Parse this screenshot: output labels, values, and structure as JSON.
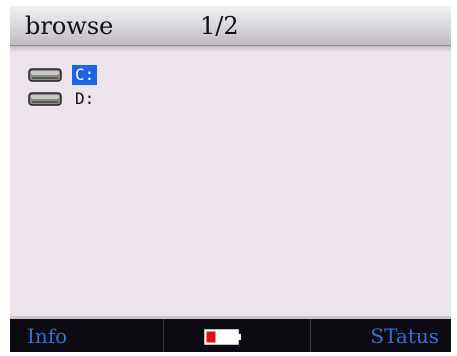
{
  "header": {
    "title": "browse",
    "page": "1/2"
  },
  "drives": [
    {
      "label": "C:",
      "selected": true
    },
    {
      "label": "D:",
      "selected": false
    }
  ],
  "footer": {
    "left_label": "Info",
    "right_label": "STatus",
    "battery_level": 0.3
  },
  "colors": {
    "background": "#ede3ec",
    "selection": "#1e63e8",
    "footer_text": "#2b73d6",
    "footer_bg": "#0c0a10",
    "battery_fill": "#e0101a"
  },
  "icons": [
    "hard-drive-icon",
    "battery-icon"
  ]
}
